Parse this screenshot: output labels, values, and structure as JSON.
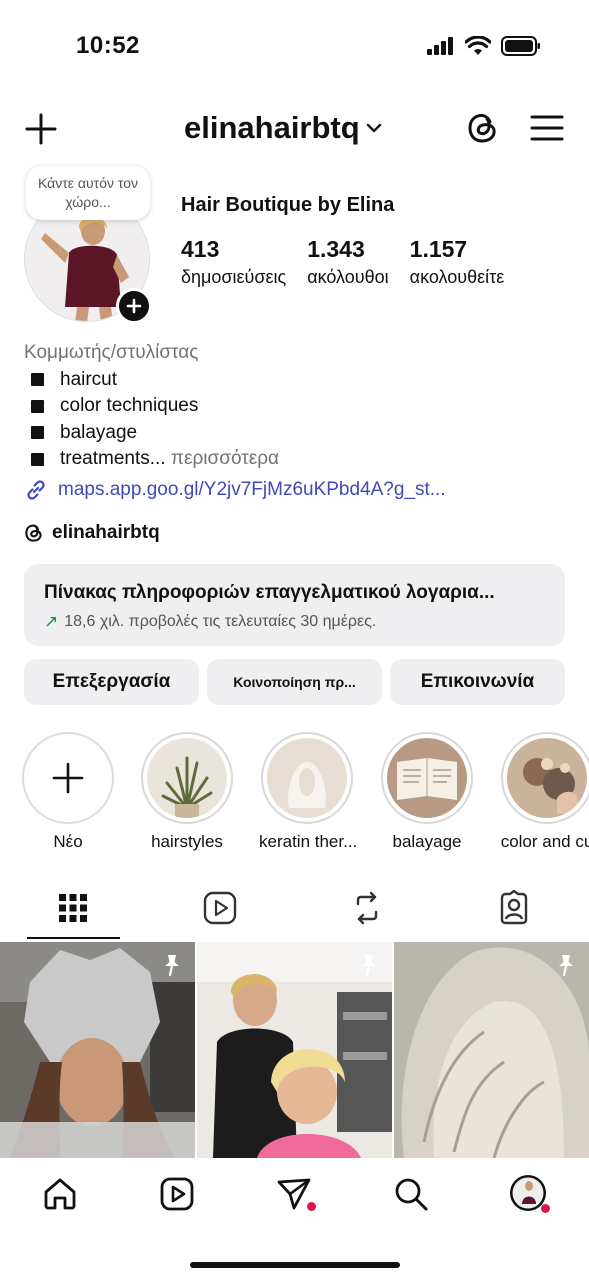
{
  "status": {
    "time": "10:52"
  },
  "header": {
    "username": "elinahairbtq"
  },
  "profile": {
    "note": "Κάντε αυτόν τον χώρο...",
    "display_name": "Hair Boutique by Elina",
    "stats": [
      {
        "value": "413",
        "label": "δημοσιεύσεις"
      },
      {
        "value": "1.343",
        "label": "ακόλουθοι"
      },
      {
        "value": "1.157",
        "label": "ακολουθείτε"
      }
    ],
    "category": "Κομμωτής/στυλίστας",
    "bio_lines": [
      "haircut",
      "color techniques",
      "balayage",
      "treatments..."
    ],
    "more": "περισσότερα",
    "link": "maps.app.goo.gl/Y2jv7FjMz6uKPbd4A?g_st...",
    "threads_handle": "elinahairbtq"
  },
  "dashboard": {
    "title": "Πίνακας πληροφοριών επαγγελματικού λογαρια...",
    "subtitle": "18,6 χιλ. προβολές τις τελευταίες 30 ημέρες."
  },
  "buttons": {
    "edit": "Επεξεργασία",
    "share": "Κοινοποίηση πρ...",
    "contact": "Επικοινωνία"
  },
  "highlights": [
    {
      "label": "Νέο"
    },
    {
      "label": "hairstyles"
    },
    {
      "label": "keratin ther..."
    },
    {
      "label": "balayage"
    },
    {
      "label": "color and cu"
    }
  ],
  "colors": {
    "link": "#3d4bb7",
    "trend_up": "#1c8b47",
    "notification_dot": "#e0144c"
  }
}
